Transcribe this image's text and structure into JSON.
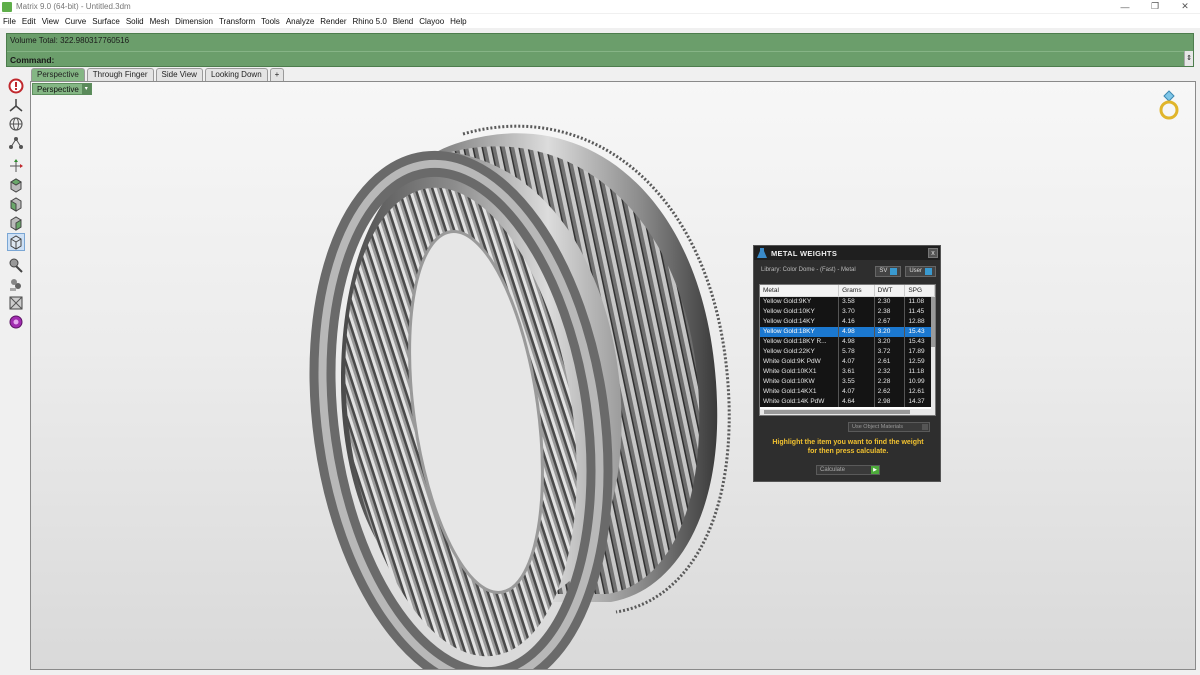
{
  "window": {
    "title": "Matrix 9.0 (64-bit) - Untitled.3dm",
    "controls": [
      "—",
      "❐",
      "✕"
    ]
  },
  "menu": [
    "File",
    "Edit",
    "View",
    "Curve",
    "Surface",
    "Solid",
    "Mesh",
    "Dimension",
    "Transform",
    "Tools",
    "Analyze",
    "Render",
    "Rhino 5.0",
    "Blend",
    "Clayoo",
    "Help"
  ],
  "command": {
    "history": "Volume Total: 322.980317760516",
    "prompt": "Command:"
  },
  "tabs": [
    "Perspective",
    "Through Finger",
    "Side View",
    "Looking Down",
    "+"
  ],
  "viewport": {
    "label": "Perspective",
    "arrow": "▾"
  },
  "toolbar": {
    "icons": [
      "info-icon",
      "axis-icon",
      "globe-icon",
      "nodes-icon",
      "gumball-icon",
      "view-top-icon",
      "view-front-icon",
      "view-right-icon",
      "view-perspective-icon",
      "brush-icon",
      "layers-icon",
      "grid-icon",
      "gem-icon"
    ]
  },
  "metal_weights": {
    "title": "METAL WEIGHTS",
    "close": "x",
    "library": "Library: Color Dome - (Fast) - Metal",
    "sv_label": "SV",
    "user_label": "User",
    "columns": [
      "Metal",
      "Grams",
      "DWT",
      "SPG"
    ],
    "rows": [
      {
        "metal": "Yellow Gold:9KY",
        "grams": "3.58",
        "dwt": "2.30",
        "spg": "11.08"
      },
      {
        "metal": "Yellow Gold:10KY",
        "grams": "3.70",
        "dwt": "2.38",
        "spg": "11.45"
      },
      {
        "metal": "Yellow Gold:14KY",
        "grams": "4.16",
        "dwt": "2.67",
        "spg": "12.88"
      },
      {
        "metal": "Yellow Gold:18KY",
        "grams": "4.98",
        "dwt": "3.20",
        "spg": "15.43"
      },
      {
        "metal": "Yellow Gold:18KY R...",
        "grams": "4.98",
        "dwt": "3.20",
        "spg": "15.43"
      },
      {
        "metal": "Yellow Gold:22KY",
        "grams": "5.78",
        "dwt": "3.72",
        "spg": "17.89"
      },
      {
        "metal": "White Gold:9K PdW",
        "grams": "4.07",
        "dwt": "2.61",
        "spg": "12.59"
      },
      {
        "metal": "White Gold:10KX1",
        "grams": "3.61",
        "dwt": "2.32",
        "spg": "11.18"
      },
      {
        "metal": "White Gold:10KW",
        "grams": "3.55",
        "dwt": "2.28",
        "spg": "10.99"
      },
      {
        "metal": "White Gold:14KX1",
        "grams": "4.07",
        "dwt": "2.62",
        "spg": "12.61"
      },
      {
        "metal": "White Gold:14K PdW",
        "grams": "4.64",
        "dwt": "2.98",
        "spg": "14.37"
      }
    ],
    "selected_index": 3,
    "use_object_materials": "Use Object Materials",
    "hint_line1": "Highlight the item you want to find the weight",
    "hint_line2": "for then press calculate.",
    "calculate": "Calculate",
    "go": "▶"
  },
  "colors": {
    "command_green": "#6b9e6b",
    "tab_active": "#84b684",
    "panel_bg": "#2e2e2e",
    "selection_blue": "#1b78d0",
    "hint_yellow": "#f2c230"
  }
}
